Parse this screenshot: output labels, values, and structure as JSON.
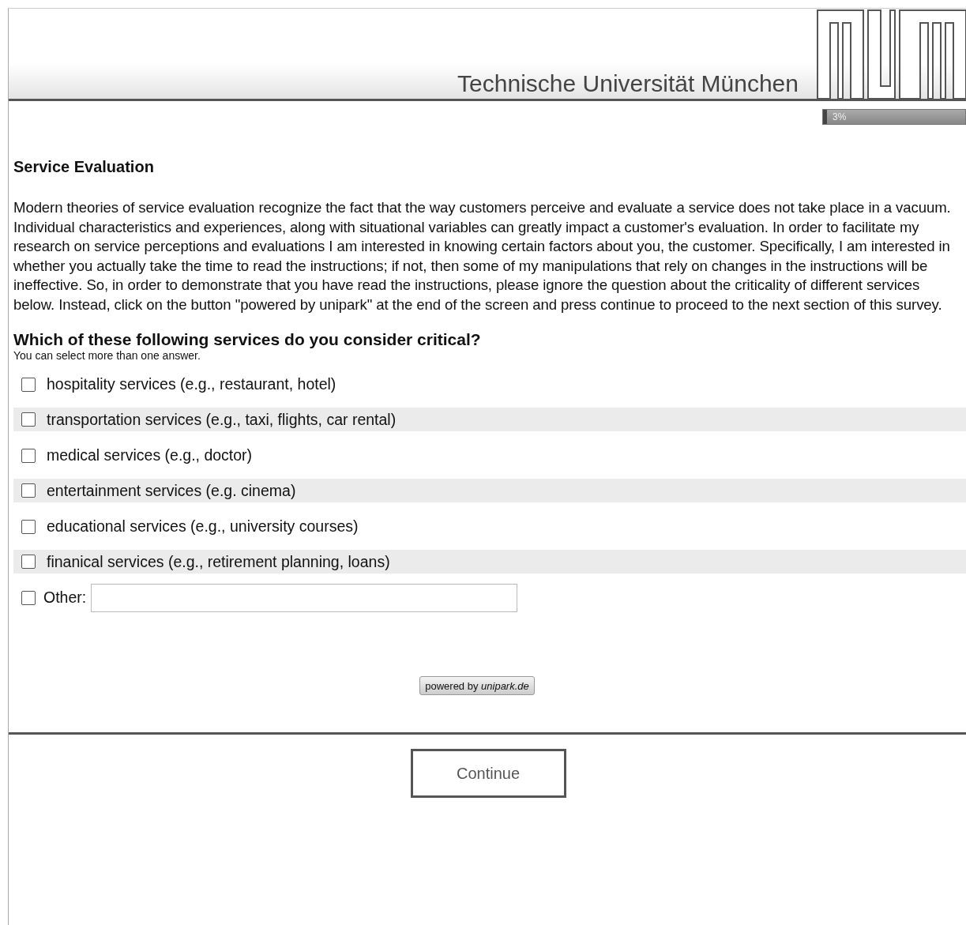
{
  "header": {
    "university": "Technische Universität München"
  },
  "progress": {
    "level": 0.03,
    "label": "3%"
  },
  "section_title": "Service Evaluation",
  "instructions": "Modern theories of service evaluation recognize the fact that the way customers perceive and evaluate a service does not take place in a vacuum. Individual characteristics and experiences, along with situational variables can greatly impact a customer's evaluation. In order to facilitate my research on service perceptions and evaluations I am interested in knowing certain factors about you, the customer. Specifically, I am interested in whether you actually take the time to read the instructions; if not, then some of my manipulations that rely on changes in the instructions will be ineffective. So, in order to demonstrate that you have read the instructions, please ignore the question about the criticality of different services below. Instead, click on the button \"powered by unipark\" at the end of the screen and press continue to proceed to the next section of this survey.",
  "question": {
    "text": "Which of these following services do you consider critical?",
    "hint": "You can select more than one answer.",
    "options": [
      {
        "kind": "checkbox",
        "label": "hospitality services (e.g., restaurant, hotel)",
        "checked": false
      },
      {
        "kind": "checkbox",
        "label": "transportation services (e.g., taxi, flights, car rental)",
        "checked": false
      },
      {
        "kind": "checkbox",
        "label": "medical services (e.g., doctor)",
        "checked": false
      },
      {
        "kind": "checkbox",
        "label": "entertainment services (e.g. cinema)",
        "checked": false
      },
      {
        "kind": "checkbox",
        "label": "educational services (e.g., university courses)",
        "checked": false
      },
      {
        "kind": "checkbox",
        "label": "finanical services (e.g., retirement planning, loans)",
        "checked": false
      },
      {
        "kind": "other",
        "label": "Other:",
        "checked": false
      }
    ]
  },
  "powered_button": "powered by *unipark.de*",
  "continue_button": "Continue"
}
